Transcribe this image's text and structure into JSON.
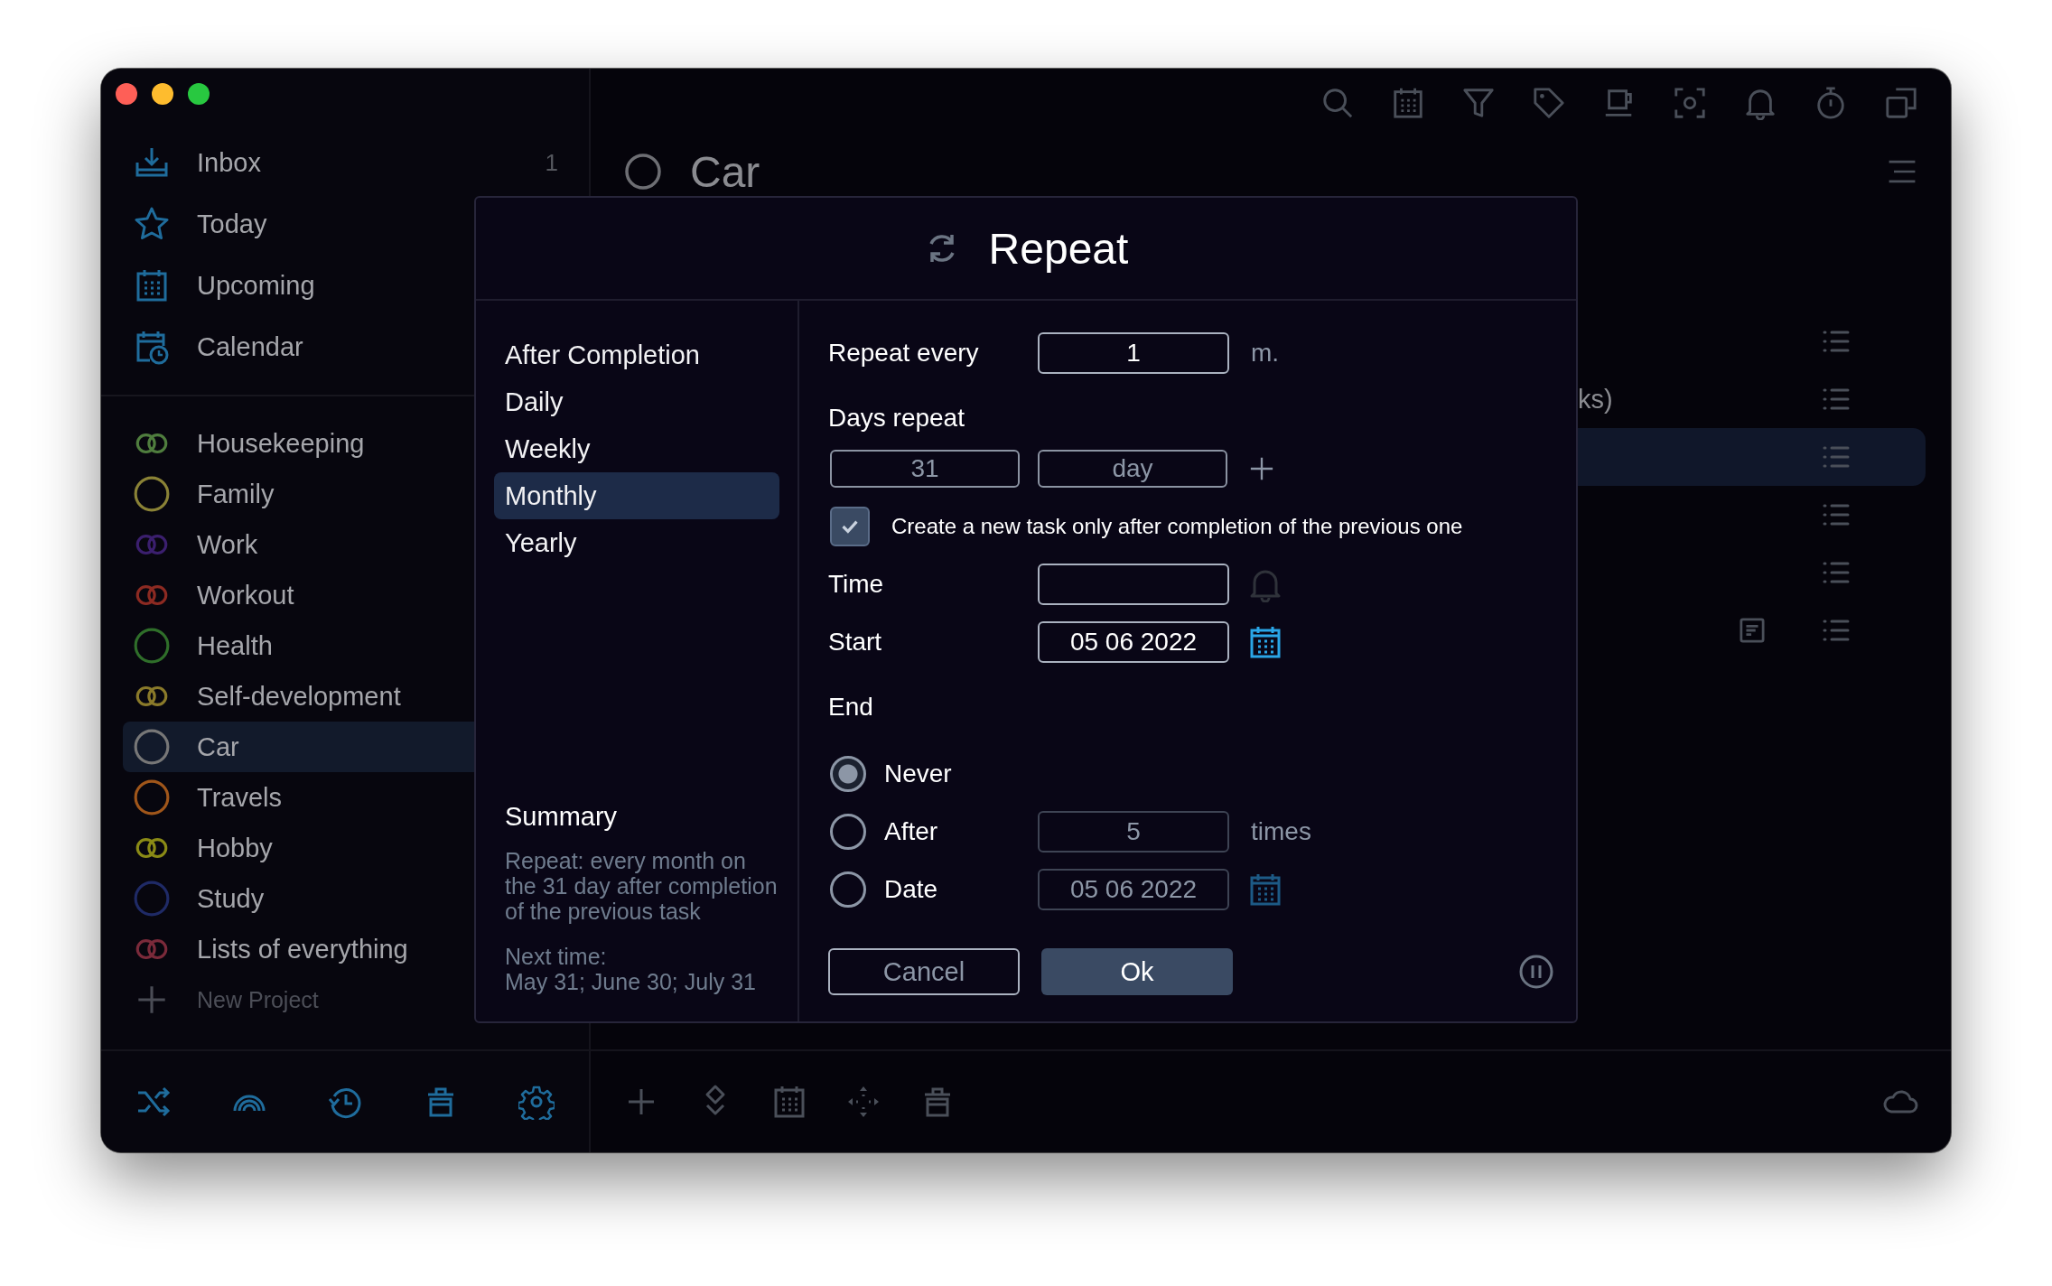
{
  "sidebar": {
    "nav": [
      {
        "label": "Inbox",
        "count": "1"
      },
      {
        "label": "Today"
      },
      {
        "label": "Upcoming"
      },
      {
        "label": "Calendar"
      }
    ],
    "projects": [
      {
        "name": "Housekeeping",
        "kind": "double",
        "color": "#4f7d3e",
        "selected": false
      },
      {
        "name": "Family",
        "kind": "single",
        "color": "#8a8236",
        "selected": false
      },
      {
        "name": "Work",
        "kind": "double",
        "color": "#3b1f6e",
        "selected": false
      },
      {
        "name": "Workout",
        "kind": "double",
        "color": "#8c2a22",
        "selected": false
      },
      {
        "name": "Health",
        "kind": "single",
        "color": "#2f6e2a",
        "selected": false
      },
      {
        "name": "Self-development",
        "kind": "double",
        "color": "#8a7a2a",
        "selected": false
      },
      {
        "name": "Car",
        "kind": "single",
        "color": "#777777",
        "selected": true
      },
      {
        "name": "Travels",
        "kind": "single",
        "color": "#a0561a",
        "selected": false
      },
      {
        "name": "Hobby",
        "kind": "double",
        "color": "#8a8a16",
        "selected": false
      },
      {
        "name": "Study",
        "kind": "single",
        "color": "#1f2a66",
        "selected": false
      },
      {
        "name": "Lists of everything",
        "kind": "double",
        "color": "#7a2a3a",
        "selected": false
      }
    ],
    "new_project": "New Project"
  },
  "main": {
    "title": "Car",
    "tasks": [
      {
        "selected": false,
        "note": false
      },
      {
        "text": "ks)",
        "selected": false,
        "note": false
      },
      {
        "selected": true,
        "note": false
      },
      {
        "selected": false,
        "note": false
      },
      {
        "selected": false,
        "note": false
      },
      {
        "selected": false,
        "note": true
      }
    ]
  },
  "dialog": {
    "title": "Repeat",
    "modes": [
      {
        "label": "After Completion",
        "selected": false
      },
      {
        "label": "Daily",
        "selected": false
      },
      {
        "label": "Weekly",
        "selected": false
      },
      {
        "label": "Monthly",
        "selected": true
      },
      {
        "label": "Yearly",
        "selected": false
      }
    ],
    "summary_title": "Summary",
    "summary": "Repeat: every month on the 31 day after completion of the previous task",
    "next_time_label": "Next time:",
    "next_times": "May 31; June 30; July 31",
    "repeat_every": {
      "label": "Repeat every",
      "value": "1",
      "unit": "m."
    },
    "days_repeat": {
      "label": "Days repeat",
      "day": "31",
      "unit": "day"
    },
    "only_after_completion": {
      "label": "Create a new task only after completion of the previous one",
      "checked": true
    },
    "time": {
      "label": "Time"
    },
    "start": {
      "label": "Start",
      "value": "05 06 2022"
    },
    "end": {
      "label": "End",
      "options": [
        {
          "label": "Never",
          "selected": true
        },
        {
          "label": "After",
          "selected": false,
          "value": "5",
          "unit": "times"
        },
        {
          "label": "Date",
          "selected": false,
          "value": "05 06 2022",
          "calendar": true
        }
      ]
    },
    "buttons": {
      "cancel": "Cancel",
      "ok": "Ok"
    }
  }
}
